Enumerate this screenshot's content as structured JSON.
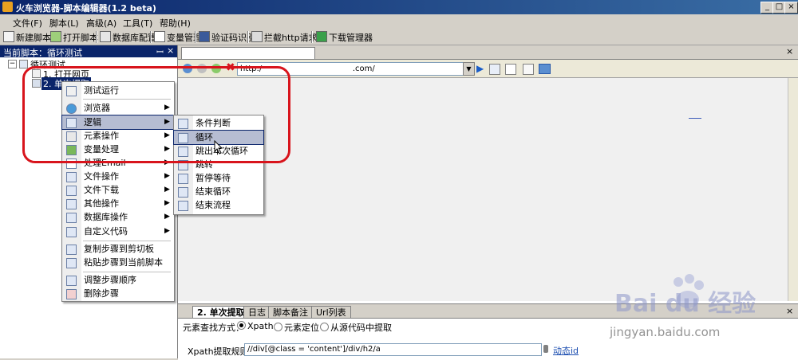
{
  "window": {
    "title": "火车浏览器-脚本编辑器(1.2 beta)",
    "controls": [
      "_",
      "□",
      "×"
    ]
  },
  "menubar": [
    "文件(F)",
    "脚本(L)",
    "高级(A)",
    "工具(T)",
    "帮助(H)"
  ],
  "toolbar": [
    "新建脚本",
    "打开脚本",
    "数据库配置",
    "变量管理",
    "验证码识别",
    "拦截http请求",
    "下载管理器"
  ],
  "left_panel": {
    "header": "当前脚本：循环测试",
    "pin": "ꟷ",
    "close": "×",
    "tree": {
      "root": "循环测试",
      "expander": "−",
      "children": [
        "1. 打开网页",
        "2. 单次提取"
      ]
    }
  },
  "right_panel": {
    "tab_close": "×",
    "url": {
      "prefix": "http:/",
      "suffix": ".com/"
    },
    "close": "×"
  },
  "context_menu": {
    "items": [
      {
        "label": "测试运行",
        "submenu": false
      },
      {
        "label": "浏览器",
        "submenu": true
      },
      {
        "label": "逻辑",
        "submenu": true,
        "highlighted": true
      },
      {
        "label": "元素操作",
        "submenu": true
      },
      {
        "label": "变量处理",
        "submenu": true
      },
      {
        "label": "处理Email",
        "submenu": true
      },
      {
        "label": "文件操作",
        "submenu": true
      },
      {
        "label": "文件下载",
        "submenu": true
      },
      {
        "label": "其他操作",
        "submenu": true
      },
      {
        "label": "数据库操作",
        "submenu": true
      },
      {
        "label": "自定义代码",
        "submenu": true
      },
      {
        "label": "复制步骤到剪切板",
        "submenu": false
      },
      {
        "label": "粘贴步骤到当前脚本",
        "submenu": false
      },
      {
        "label": "调整步骤顺序",
        "submenu": false
      },
      {
        "label": "删除步骤",
        "submenu": false
      }
    ],
    "arrow": "▶"
  },
  "submenu": {
    "items": [
      "条件判断",
      "循环",
      "跳出本次循环",
      "跳转",
      "暂停等待",
      "结束循环",
      "结束流程"
    ],
    "highlighted_index": 1
  },
  "bottom_panel": {
    "tabs": [
      "2. 单次提取",
      "日志",
      "脚本备注",
      "Url列表"
    ],
    "close": "×",
    "find_mode_label": "元素查找方式：",
    "find_modes": [
      "Xpath",
      "元素定位",
      "从源代码中提取"
    ],
    "selected_mode": "Xpath",
    "xpath_label": "Xpath提取规则",
    "xpath_value": "//div[@class = 'content']/div/h2/a",
    "dynamic_id_link": "动态id"
  },
  "watermark": {
    "brand": "Bai du 经验",
    "url": "jingyan.baidu.com"
  },
  "colors": {
    "titlebar": "#0a246a",
    "menu_highlight": "#b6bdd2",
    "annotation_ring": "#d8141c"
  }
}
